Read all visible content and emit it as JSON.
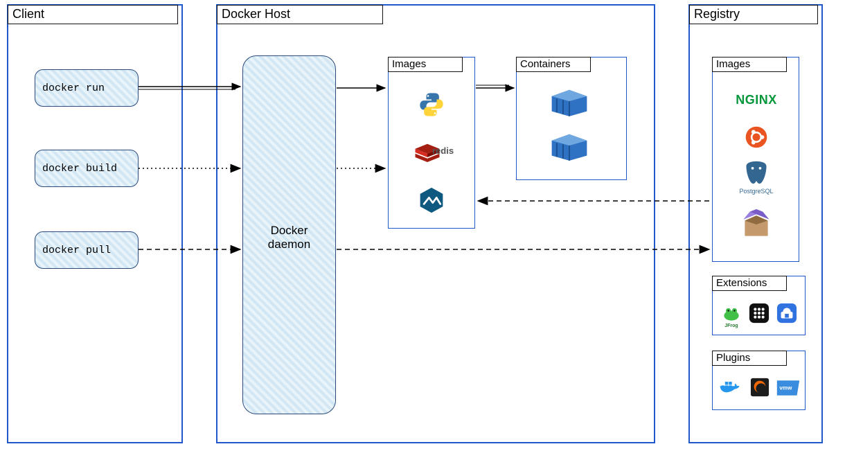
{
  "panels": {
    "client": {
      "title": "Client"
    },
    "host": {
      "title": "Docker Host"
    },
    "registry": {
      "title": "Registry"
    }
  },
  "client_commands": {
    "run": "docker run",
    "build": "docker build",
    "pull": "docker pull"
  },
  "daemon_label": "Docker\ndaemon",
  "host_boxes": {
    "images": {
      "title": "Images"
    },
    "containers": {
      "title": "Containers"
    }
  },
  "host_images_icons": [
    "python",
    "redis",
    "alpine"
  ],
  "host_containers_count": 2,
  "registry_sections": {
    "images": {
      "title": "Images",
      "icons": [
        "nginx",
        "ubuntu",
        "postgresql",
        "package"
      ]
    },
    "extensions": {
      "title": "Extensions",
      "icons": [
        "jfrog",
        "grid-app",
        "cloud-app"
      ]
    },
    "plugins": {
      "title": "Plugins",
      "icons": [
        "docker",
        "grafana",
        "vmw"
      ]
    }
  },
  "connections": [
    {
      "from": "docker run",
      "through": "daemon",
      "to": "images→containers",
      "style": "solid"
    },
    {
      "from": "docker build",
      "through": "daemon",
      "to": "images",
      "style": "dotted"
    },
    {
      "from": "docker pull",
      "through": "daemon",
      "to": "registry/images",
      "style": "dashed",
      "also_to": "images"
    },
    {
      "from": "registry/images",
      "to": "host/images",
      "style": "dashed"
    }
  ]
}
